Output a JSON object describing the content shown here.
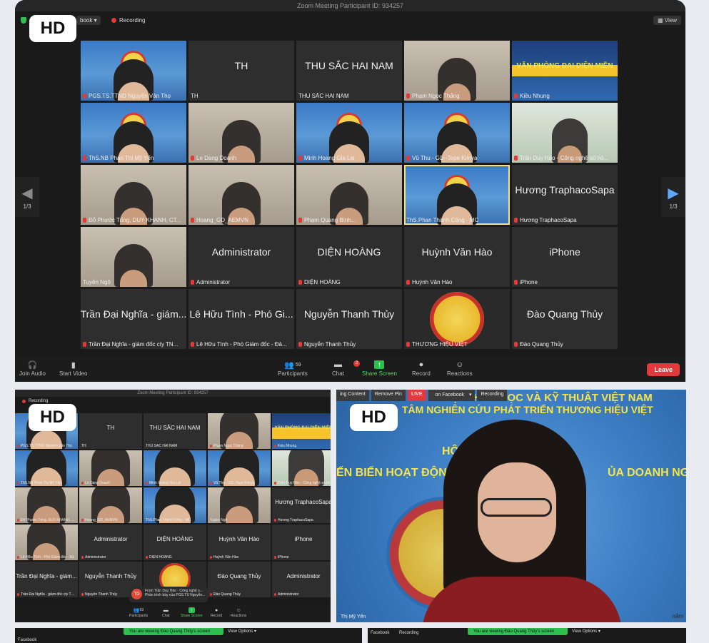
{
  "shot1": {
    "hd_badge": "HD",
    "meeting_title": "Zoom Meeting Participant ID: 934257",
    "facebook_label": "book",
    "recording_label": "Recording",
    "view_label": "View",
    "page_left": "1/3",
    "page_right": "1/3",
    "tiles": [
      {
        "label": "PGS.TS.TTND Nguyễn Văn Thọ",
        "big": "",
        "style": "vid",
        "muted": true,
        "active": false
      },
      {
        "label": "TH",
        "big": "TH",
        "style": "name",
        "muted": false,
        "active": false
      },
      {
        "label": "THU SẮC HAI NAM",
        "big": "THU SẮC HAI NAM",
        "style": "name",
        "muted": false,
        "active": false
      },
      {
        "label": "Phạm Ngọc Thắng",
        "big": "",
        "style": "room",
        "muted": true,
        "active": false
      },
      {
        "label": "Kiều Nhung",
        "big": "VĂN PHÒNG ĐẠI DIỆN MIỀN",
        "style": "banner",
        "muted": true,
        "active": false
      },
      {
        "label": "ThS.NB Phan Thị Mỹ Yến",
        "big": "",
        "style": "vid",
        "muted": true,
        "active": false
      },
      {
        "label": "Le Dang Doanh",
        "big": "",
        "style": "room",
        "muted": true,
        "active": false
      },
      {
        "label": "Minh Hoang Gia Lai",
        "big": "",
        "style": "vid",
        "muted": true,
        "active": false
      },
      {
        "label": "Vũ Thu - GD -Tepe Kimya",
        "big": "",
        "style": "vid",
        "muted": true,
        "active": false
      },
      {
        "label": "Trần Duy Hảo - Công nghệ số hó...",
        "big": "",
        "style": "green",
        "muted": true,
        "active": false
      },
      {
        "label": "Đỗ Phước Tống, DUY KHANH, CT...",
        "big": "",
        "style": "room",
        "muted": true,
        "active": false
      },
      {
        "label": "Hoang_GD_AEMVN",
        "big": "",
        "style": "room",
        "muted": true,
        "active": false
      },
      {
        "label": "Phạm Quang Bình...",
        "big": "",
        "style": "room",
        "muted": true,
        "active": false
      },
      {
        "label": "ThS.Phan Thành Công - MC",
        "big": "",
        "style": "vid",
        "muted": false,
        "active": true
      },
      {
        "label": "Hương TraphacoSapa",
        "big": "Hương TraphacoSapa",
        "style": "name",
        "muted": true,
        "active": false
      },
      {
        "label": "Tuyền Ngô",
        "big": "",
        "style": "room",
        "muted": false,
        "active": false
      },
      {
        "label": "Administrator",
        "big": "Administrator",
        "style": "name",
        "muted": true,
        "active": false
      },
      {
        "label": "DIỆN HOÀNG",
        "big": "DIỆN HOÀNG",
        "style": "name",
        "muted": true,
        "active": false
      },
      {
        "label": "Huỳnh Văn Hào",
        "big": "Huỳnh Văn Hào",
        "style": "name",
        "muted": true,
        "active": false
      },
      {
        "label": "iPhone",
        "big": "iPhone",
        "style": "name",
        "muted": true,
        "active": false
      },
      {
        "label": "Trần Đại Nghĩa - giám đốc cty TN...",
        "big": "Trần Đại Nghĩa - giám...",
        "style": "name",
        "muted": true,
        "active": false
      },
      {
        "label": "Lê Hữu Tình - Phó Giám đốc - Đả...",
        "big": "Lê Hữu Tình - Phó Gi...",
        "style": "name",
        "muted": true,
        "active": false
      },
      {
        "label": "Nguyễn Thanh Thủy",
        "big": "Nguyễn Thanh Thủy",
        "style": "name",
        "muted": true,
        "active": false
      },
      {
        "label": "THƯƠNG HIỆU VIỆT",
        "big": "",
        "style": "logo",
        "muted": true,
        "active": false
      },
      {
        "label": "Đào Quang Thủy",
        "big": "Đào Quang Thủy",
        "style": "name",
        "muted": true,
        "active": false
      }
    ],
    "toolbar": {
      "join_audio": "Join Audio",
      "start_video": "Start Video",
      "participants": "Participants",
      "participants_count": "59",
      "chat": "Chat",
      "chat_badge": "2",
      "share_screen": "Share Screen",
      "record": "Record",
      "reactions": "Reactions",
      "leave": "Leave"
    }
  },
  "shot2": {
    "hd_badge": "HD",
    "meeting_title": "Zoom Meeting Participant ID: 934257",
    "recording_label": "Recording",
    "tiles": [
      {
        "label": "PGS.TS.TTND Nguyễn Văn Thọ",
        "big": "",
        "style": "vid",
        "muted": true
      },
      {
        "label": "TH",
        "big": "TH",
        "style": "name",
        "muted": false
      },
      {
        "label": "THU SẮC HAI NAM",
        "big": "THU SẮC HAI NAM",
        "style": "name",
        "muted": false
      },
      {
        "label": "Phạm Ngọc Thắng",
        "big": "",
        "style": "room",
        "muted": true
      },
      {
        "label": "Kiều Nhung",
        "big": "VĂN PHÒNG ĐẠI DIỆN MIỀN",
        "style": "banner",
        "muted": true
      },
      {
        "label": "ThS.NB Phan Thị Mỹ Yến",
        "big": "",
        "style": "vid",
        "muted": true
      },
      {
        "label": "Le Dang Doanh",
        "big": "",
        "style": "room",
        "muted": true
      },
      {
        "label": "Minh Hoang Gia Lai",
        "big": "",
        "style": "vid",
        "muted": true
      },
      {
        "label": "Vũ Thu - GD -Tepe Kimya",
        "big": "",
        "style": "vid",
        "muted": true
      },
      {
        "label": "Trần Duy Hảo - Công nghệ số hó",
        "big": "",
        "style": "green",
        "muted": true
      },
      {
        "label": "Đỗ Phước Tống, DUY KHANH, CT...",
        "big": "",
        "style": "room",
        "muted": true
      },
      {
        "label": "Hoang_GD_AEMVN",
        "big": "",
        "style": "room",
        "muted": true
      },
      {
        "label": "ThS.Phan Thành Công - MC",
        "big": "",
        "style": "vid",
        "muted": false
      },
      {
        "label": "Tuyền Ngô",
        "big": "",
        "style": "room",
        "muted": false
      },
      {
        "label": "Hương TraphacoSapa",
        "big": "Hương TraphacoSapa",
        "style": "name",
        "muted": true
      },
      {
        "label": "Lê Hữu Tình - Phó Giám đốc - Đả",
        "big": "",
        "style": "room",
        "muted": true
      },
      {
        "label": "Administrator",
        "big": "Administrator",
        "style": "name",
        "muted": true
      },
      {
        "label": "DIỆN HOÀNG",
        "big": "DIỆN HOÀNG",
        "style": "name",
        "muted": true
      },
      {
        "label": "Huỳnh Văn Hào",
        "big": "Huỳnh Văn Hào",
        "style": "name",
        "muted": true
      },
      {
        "label": "iPhone",
        "big": "iPhone",
        "style": "name",
        "muted": true
      },
      {
        "label": "Trần Đại Nghĩa - giám đốc cty TN...",
        "big": "Trần Đại Nghĩa - giám...",
        "style": "name",
        "muted": true
      },
      {
        "label": "Nguyễn Thanh Thủy",
        "big": "Nguyễn Thanh Thủy",
        "style": "name",
        "muted": true
      },
      {
        "label": "THƯƠNG HIỆU VIỆT",
        "big": "",
        "style": "logo",
        "muted": true
      },
      {
        "label": "Đào Quang Thủy",
        "big": "Đào Quang Thủy",
        "style": "name",
        "muted": true
      },
      {
        "label": "Administrator",
        "big": "Administrator",
        "style": "name",
        "muted": true
      }
    ],
    "chat_popup": {
      "avatar": "TD",
      "line1": "From Trần Duy Hảo - Công nghệ s...",
      "line2": "Phần trình bày của PGS.TS Nguyễn..."
    },
    "toolbar": {
      "participants": "Participants",
      "participants_count": "59",
      "chat": "Chat",
      "share_screen": "Share Screen",
      "record": "Record",
      "reactions": "Reactions"
    }
  },
  "shot3": {
    "hd_badge": "HD",
    "buttons": [
      "ing Content",
      "Remove Pin",
      "LIVE",
      "on Facebook"
    ],
    "recording_label": "Recording",
    "headline1": "HỘI KHOA HỌC VÀ KỸ THUẬT VIỆT NAM",
    "headline2": "TÂM NGHIÊN CỨU PHÁT TRIỂN THƯƠNG HIỆU VIỆT",
    "headline3": "ẾN BIẾN HOẠT ĐỘNG",
    "headline4": "ỦA DOANH NGHI",
    "hoi_label": "HỘI T",
    "name_label": "Thị Mỹ Yến",
    "year_label": "năm"
  },
  "shot4": {
    "viewing": "You are viewing Đào Quang Thủy's screen",
    "view_options": "View Options",
    "facebook": "Facebook"
  },
  "shot5": {
    "viewing": "You are viewing Đào Quang Thủy's screen",
    "view_options": "View Options",
    "facebook": "Facebook",
    "recording_label": "Recording"
  }
}
